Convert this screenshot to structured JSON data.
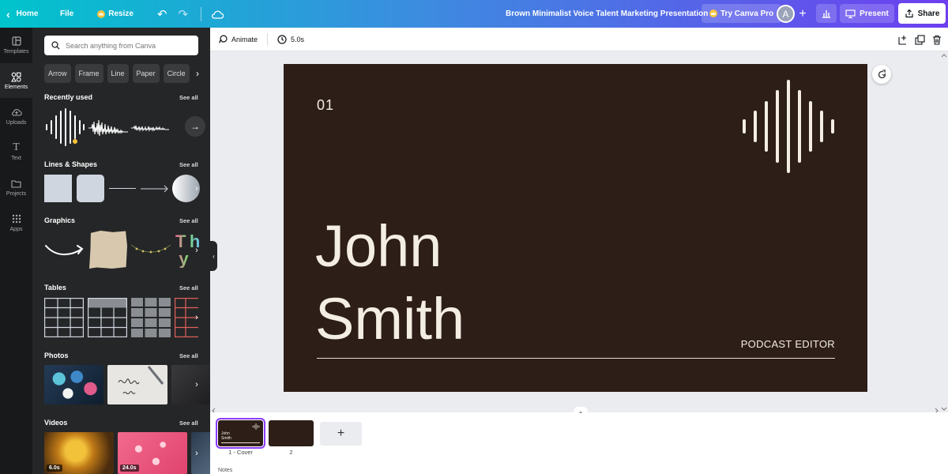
{
  "topbar": {
    "home": "Home",
    "file": "File",
    "resize": "Resize",
    "title": "Brown Minimalist Voice Talent Marketing Presentation",
    "try_pro": "Try Canva Pro",
    "avatar": "A",
    "present": "Present",
    "share": "Share"
  },
  "rail": [
    {
      "label": "Templates",
      "icon": "templates-icon"
    },
    {
      "label": "Elements",
      "icon": "elements-icon"
    },
    {
      "label": "Uploads",
      "icon": "uploads-icon"
    },
    {
      "label": "Text",
      "icon": "text-icon"
    },
    {
      "label": "Projects",
      "icon": "projects-icon"
    },
    {
      "label": "Apps",
      "icon": "apps-icon"
    }
  ],
  "panel": {
    "search_placeholder": "Search anything from Canva",
    "chips": [
      "Arrow",
      "Frame",
      "Line",
      "Paper",
      "Circle"
    ],
    "see_all": "See all",
    "sections": {
      "recent": "Recently used",
      "lines": "Lines & Shapes",
      "graphics": "Graphics",
      "tables": "Tables",
      "photos": "Photos",
      "videos": "Videos"
    },
    "videos": [
      "6.0s",
      "24.0s"
    ]
  },
  "context_bar": {
    "animate": "Animate",
    "duration": "5.0s"
  },
  "slide": {
    "number": "01",
    "first_name": "John",
    "last_name": "Smith",
    "role": "PODCAST EDITOR",
    "bg": "#2d1e18",
    "fg": "#f4eee2"
  },
  "filmstrip": {
    "pages": [
      {
        "label": "1 - Cover",
        "thumb_line1": "John",
        "thumb_line2": "Smith"
      },
      {
        "label": "2"
      }
    ],
    "add": "+",
    "notes": "Notes"
  },
  "colors": {
    "accent": "#8b3dff",
    "topbar_start": "#00c4cc",
    "topbar_end": "#6d3ff0"
  }
}
